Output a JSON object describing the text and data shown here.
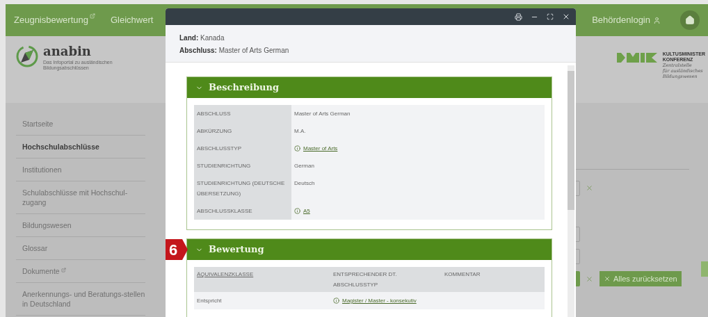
{
  "nav": {
    "items": [
      {
        "label": "Zeugnisbewertung",
        "external": true
      },
      {
        "label": "Gleichwert",
        "external": false
      }
    ],
    "login": "Behördenlogin"
  },
  "header": {
    "logo_name": "anabin",
    "logo_subtitle": [
      "Das Infoportal zu ausländischen",
      "Bildungsabschlüssen"
    ],
    "kmk_title": [
      "KULTUSMINISTER",
      "KONFERENZ"
    ],
    "kmk_subtitle": [
      "Zentralstelle",
      "für ausländisches",
      "Bildungswesen"
    ]
  },
  "sidebar": {
    "items": [
      {
        "label": "Startseite",
        "selected": false,
        "external": false
      },
      {
        "label": "Hochschulabschlüsse",
        "selected": true,
        "external": false
      },
      {
        "label": "Institutionen",
        "selected": false,
        "external": false
      },
      {
        "label": "Schulabschlüsse mit Hochschul-zugang",
        "selected": false,
        "external": false
      },
      {
        "label": "Bildungswesen",
        "selected": false,
        "external": false
      },
      {
        "label": "Glossar",
        "selected": false,
        "external": false
      },
      {
        "label": "Dokumente",
        "selected": false,
        "external": true
      },
      {
        "label": "Anerkennungs- und Beratungs-stellen in Deutschland",
        "selected": false,
        "external": false
      }
    ]
  },
  "background_form": {
    "reset_button": "Alles zurücksetzen"
  },
  "modal": {
    "info": [
      {
        "label": "Land:",
        "value": "Kanada"
      },
      {
        "label": "Abschluss:",
        "value": "Master of Arts German"
      }
    ],
    "sections": [
      {
        "kind": "details",
        "title": "Beschreibung",
        "expanded": true,
        "rows": [
          {
            "label": "ABSCHLUSS",
            "value": "Master of Arts German",
            "link": false
          },
          {
            "label": "ABKÜRZUNG",
            "value": "M.A.",
            "link": false
          },
          {
            "label": "ABSCHLUSSTYP",
            "value": "Master of Arts",
            "link": true
          },
          {
            "label": "STUDIENRICHTUNG",
            "value": "German",
            "link": false
          },
          {
            "label": "STUDIENRICHTUNG (DEUTSCHE ÜBERSETZUNG)",
            "value": "Deutsch",
            "link": false
          },
          {
            "label": "ABSCHLUSSKLASSE",
            "value": "A5",
            "link": true
          }
        ]
      },
      {
        "kind": "table",
        "title": "Bewertung",
        "expanded": true,
        "badge": "6",
        "columns": [
          {
            "label": "ÄQUIVALENZKLASSE",
            "sortable": true
          },
          {
            "label": "ENTSPRECHENDER DT. ABSCHLUSSTYP",
            "sortable": false
          },
          {
            "label": "KOMMENTAR",
            "sortable": false
          }
        ],
        "rows": [
          [
            {
              "text": "Entspricht",
              "link": false
            },
            {
              "text": "Magister / Master - konsekutiv",
              "link": true
            }
          ]
        ]
      }
    ]
  }
}
